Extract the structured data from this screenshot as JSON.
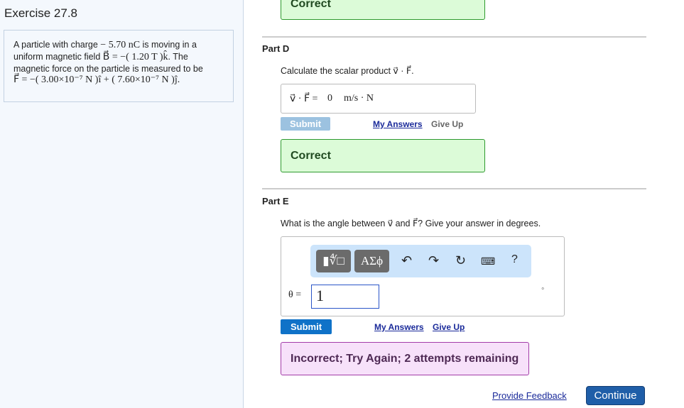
{
  "exercise_title": "Exercise 27.8",
  "problem": {
    "l1a": "A particle with charge",
    "l1b": "− 5.70",
    "l1c": "nC",
    "l1d": "is moving in a",
    "l2a": "uniform magnetic field",
    "l2b": "B⃗ = −( 1.20 T )k̂",
    "l2c": ". The",
    "l3": "magnetic force on the particle is measured to be",
    "l4": "F⃗ = −( 3.00×10⁻⁷ N )î + ( 7.60×10⁻⁷ N )ĵ."
  },
  "top_feedback": "Correct",
  "partD": {
    "label": "Part D",
    "question": "Calculate the scalar product v⃗ · F⃗.",
    "answer_label": "v⃗ · F⃗ =",
    "answer_value": "0",
    "answer_units": "m/s · N",
    "submit": "Submit",
    "my_answers": "My Answers",
    "give_up": "Give Up",
    "feedback": "Correct"
  },
  "partE": {
    "label": "Part E",
    "question": "What is the angle between v⃗ and F⃗? Give your answer in degrees.",
    "toolbar": {
      "templates": "▮∜□",
      "greek": "ΑΣϕ",
      "help": "?"
    },
    "answer_label": "θ =",
    "answer_value": "1",
    "units": "°",
    "submit": "Submit",
    "my_answers": "My Answers",
    "give_up": "Give Up",
    "feedback": "Incorrect; Try Again; 2 attempts remaining"
  },
  "footer": {
    "feedback_link": "Provide Feedback",
    "continue": "Continue"
  }
}
